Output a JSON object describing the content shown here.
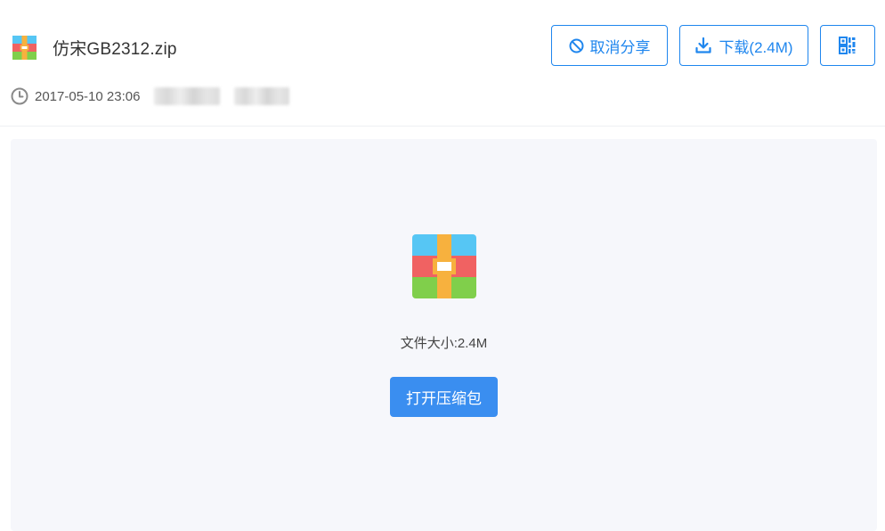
{
  "file": {
    "name": "仿宋GB2312.zip",
    "icon": "zip-archive-icon"
  },
  "meta": {
    "timestamp": "2017-05-10 23:06"
  },
  "toolbar": {
    "cancel_share_label": "取消分享",
    "download_label": "下载(2.4M)",
    "qr_icon": "qr-code-icon"
  },
  "preview": {
    "size_text": "文件大小:2.4M",
    "open_archive_label": "打开压缩包"
  },
  "colors": {
    "accent": "#1f86ee",
    "primary_button": "#3a8ef0",
    "content_bg": "#f6f7fb"
  }
}
